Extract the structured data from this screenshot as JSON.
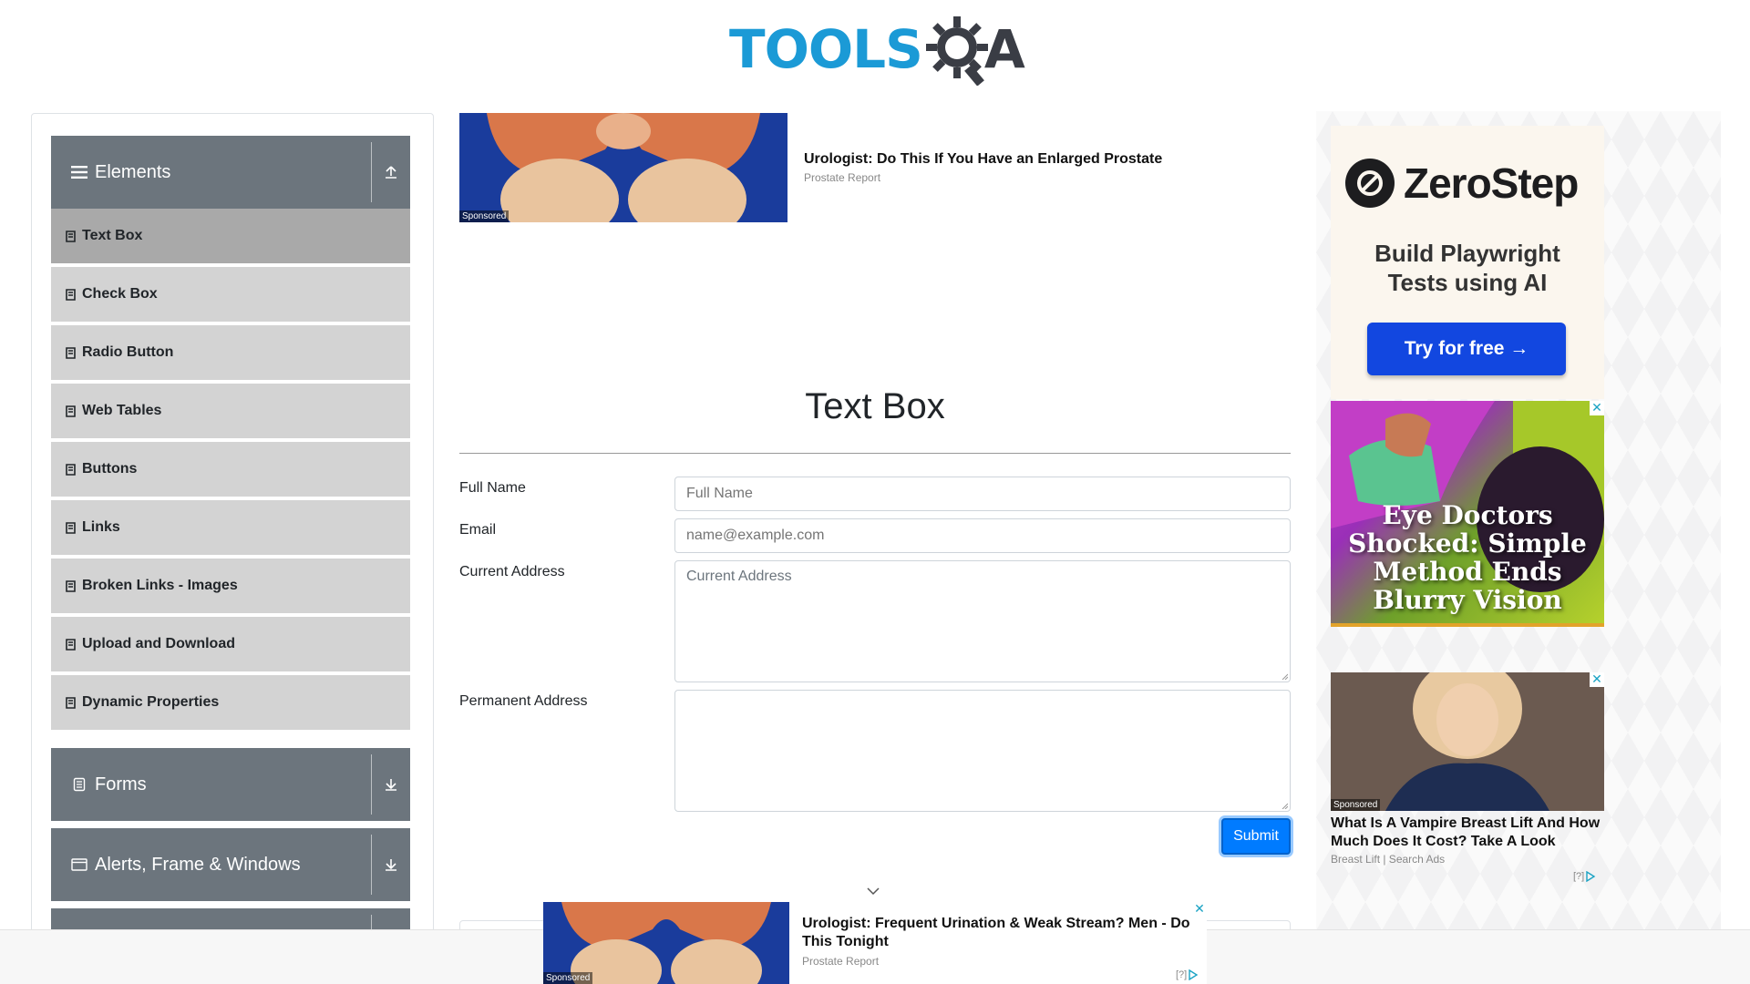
{
  "header": {
    "logo_text_left": "TOOLS",
    "logo_text_right": "A",
    "logo_colors": {
      "tools": "#1b9ad6",
      "gear": "#3a3d45"
    }
  },
  "sidebar": {
    "groups": [
      {
        "label": "Elements",
        "icon": "hamburger-icon",
        "toggle_icon": "collapse-up-icon",
        "expanded": true
      },
      {
        "label": "Forms",
        "icon": "form-icon",
        "toggle_icon": "expand-down-icon",
        "expanded": false
      },
      {
        "label": "Alerts, Frame & Windows",
        "icon": "window-icon",
        "toggle_icon": "expand-down-icon",
        "expanded": false
      }
    ],
    "items": [
      {
        "label": "Text Box",
        "active": true
      },
      {
        "label": "Check Box"
      },
      {
        "label": "Radio Button"
      },
      {
        "label": "Web Tables"
      },
      {
        "label": "Buttons"
      },
      {
        "label": "Links"
      },
      {
        "label": "Broken Links - Images"
      },
      {
        "label": "Upload and Download"
      },
      {
        "label": "Dynamic Properties"
      }
    ]
  },
  "ads": {
    "top": {
      "sponsored": "Sponsored",
      "title": "Urologist: Do This If You Have an Enlarged Prostate",
      "source": "Prostate Report"
    },
    "zerostep": {
      "brand": "ZeroStep",
      "tagline_line1": "Build Playwright",
      "tagline_line2": "Tests using AI",
      "cta": "Try for free →",
      "bg": "#fbf6ee",
      "cta_color": "#1247e0"
    },
    "eye": {
      "headline_line1": "Eye Doctors",
      "headline_line2": "Shocked: Simple",
      "headline_line3": "Method Ends",
      "headline_line4": "Blurry Vision"
    },
    "breast": {
      "sponsored": "Sponsored",
      "title": "What Is A Vampire Breast Lift And How Much Does It Cost? Take A Look",
      "source": "Breast Lift | Search Ads",
      "adchoices": "[?]"
    },
    "bottom": {
      "sponsored": "Sponsored",
      "title": "Urologist: Frequent Urination & Weak Stream? Men - Do This Tonight",
      "source": "Prostate Report",
      "adchoices": "[?]"
    },
    "close_glyph": "✕"
  },
  "main": {
    "title": "Text Box",
    "fields": {
      "full_name": {
        "label": "Full Name",
        "placeholder": "Full Name",
        "value": ""
      },
      "email": {
        "label": "Email",
        "placeholder": "name@example.com",
        "value": ""
      },
      "current_address": {
        "label": "Current Address",
        "placeholder": "Current Address",
        "value": ""
      },
      "permanent_address": {
        "label": "Permanent Address",
        "placeholder": "",
        "value": ""
      }
    },
    "submit_label": "Submit",
    "submit_color": "#007bff"
  }
}
